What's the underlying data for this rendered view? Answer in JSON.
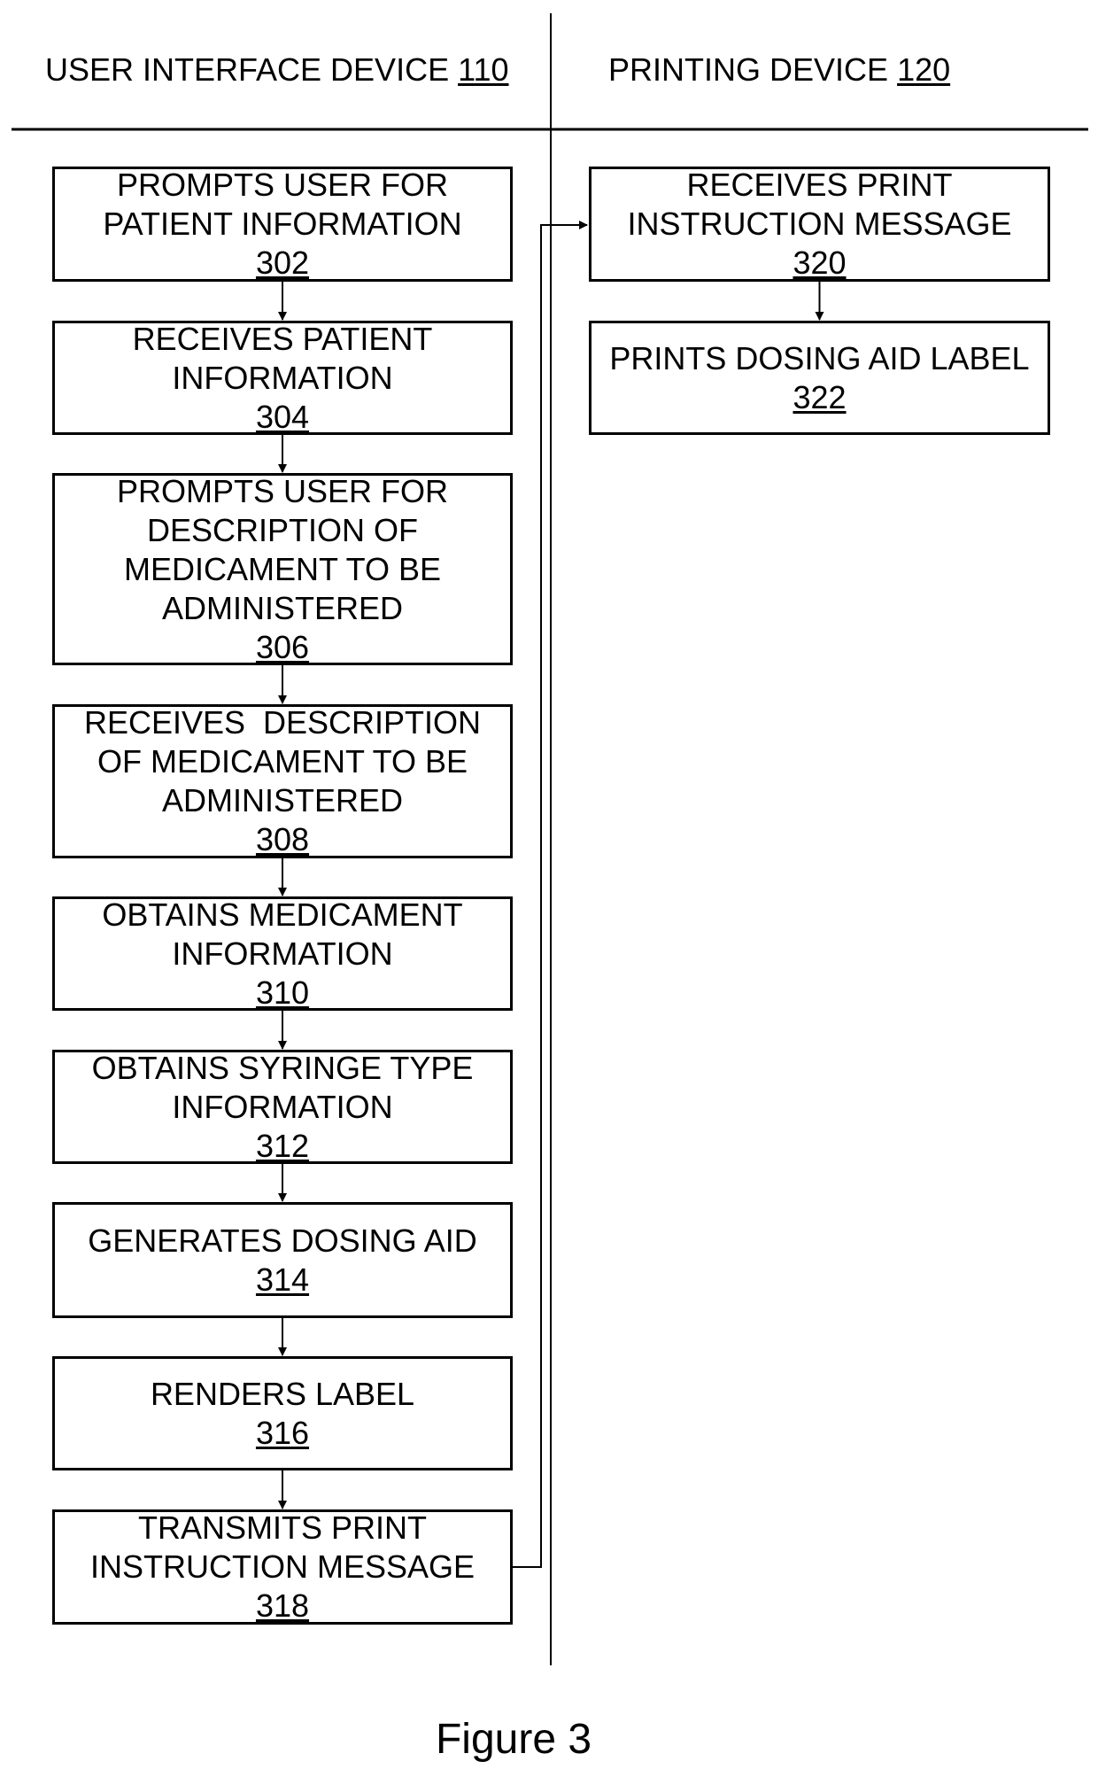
{
  "lanes": [
    {
      "title": "USER INTERFACE DEVICE",
      "ref": "110"
    },
    {
      "title": "PRINTING DEVICE",
      "ref": "120"
    }
  ],
  "steps": [
    {
      "id": "302",
      "lines": [
        "PROMPTS USER FOR",
        "PATIENT INFORMATION"
      ]
    },
    {
      "id": "304",
      "lines": [
        "RECEIVES PATIENT",
        "INFORMATION"
      ]
    },
    {
      "id": "306",
      "lines": [
        "PROMPTS USER FOR",
        "DESCRIPTION OF",
        "MEDICAMENT TO BE",
        "ADMINISTERED"
      ]
    },
    {
      "id": "308",
      "lines": [
        "RECEIVES  DESCRIPTION",
        "OF MEDICAMENT TO BE",
        "ADMINISTERED"
      ]
    },
    {
      "id": "310",
      "lines": [
        "OBTAINS MEDICAMENT",
        "INFORMATION"
      ]
    },
    {
      "id": "312",
      "lines": [
        "OBTAINS SYRINGE TYPE",
        "INFORMATION"
      ]
    },
    {
      "id": "314",
      "lines": [
        "GENERATES DOSING AID"
      ]
    },
    {
      "id": "316",
      "lines": [
        "RENDERS LABEL"
      ]
    },
    {
      "id": "318",
      "lines": [
        "TRANSMITS PRINT",
        "INSTRUCTION MESSAGE"
      ]
    },
    {
      "id": "320",
      "lines": [
        "RECEIVES PRINT",
        "INSTRUCTION MESSAGE"
      ]
    },
    {
      "id": "322",
      "lines": [
        "PRINTS DOSING AID LABEL"
      ]
    }
  ],
  "caption": "Figure 3"
}
